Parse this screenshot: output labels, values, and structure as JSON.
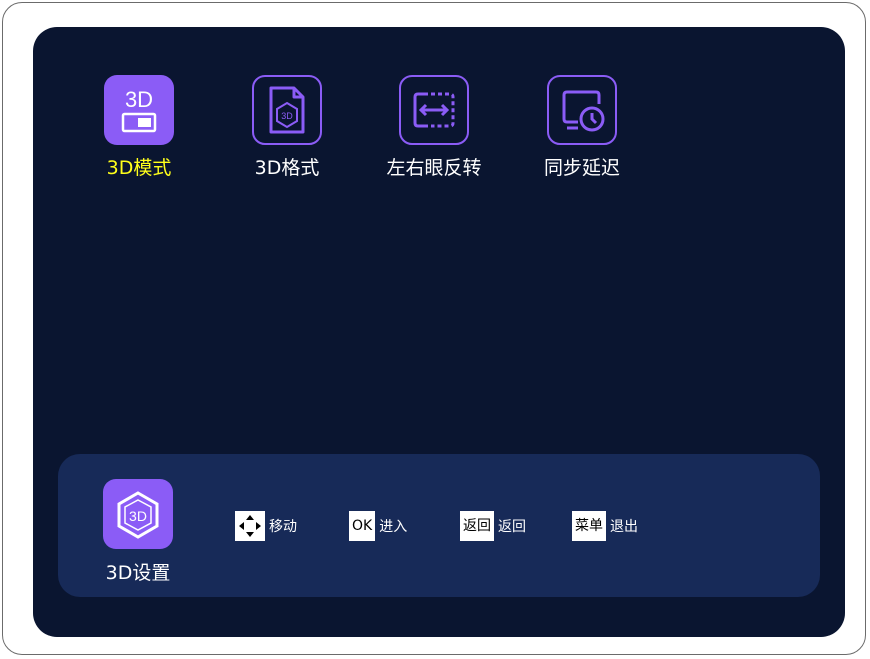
{
  "menu": {
    "items": [
      {
        "label": "3D模式",
        "icon_text": "3D",
        "icon": "3d-mode-toggle-icon",
        "selected": true
      },
      {
        "label": "3D格式",
        "icon_text": "3D",
        "icon": "3d-format-document-icon",
        "selected": false
      },
      {
        "label": "左右眼反转",
        "icon": "swap-left-right-icon",
        "selected": false
      },
      {
        "label": "同步延迟",
        "icon": "sync-delay-clock-icon",
        "selected": false
      }
    ]
  },
  "footer": {
    "title": "3D设置",
    "icon_text": "3D",
    "icon": "3d-cube-icon",
    "hints": [
      {
        "key": "",
        "key_icon": "dpad-arrows-icon",
        "text": "移动"
      },
      {
        "key": "OK",
        "text": "进入"
      },
      {
        "key": "返回",
        "text": "返回"
      },
      {
        "key": "菜单",
        "text": "退出"
      }
    ]
  },
  "colors": {
    "background": "#0a1530",
    "footer": "#172a58",
    "accent": "#8b5cf6",
    "selected_text": "#ffff1a",
    "text": "#ffffff",
    "page": "#ffffff",
    "frame": "#6b6b6b"
  }
}
